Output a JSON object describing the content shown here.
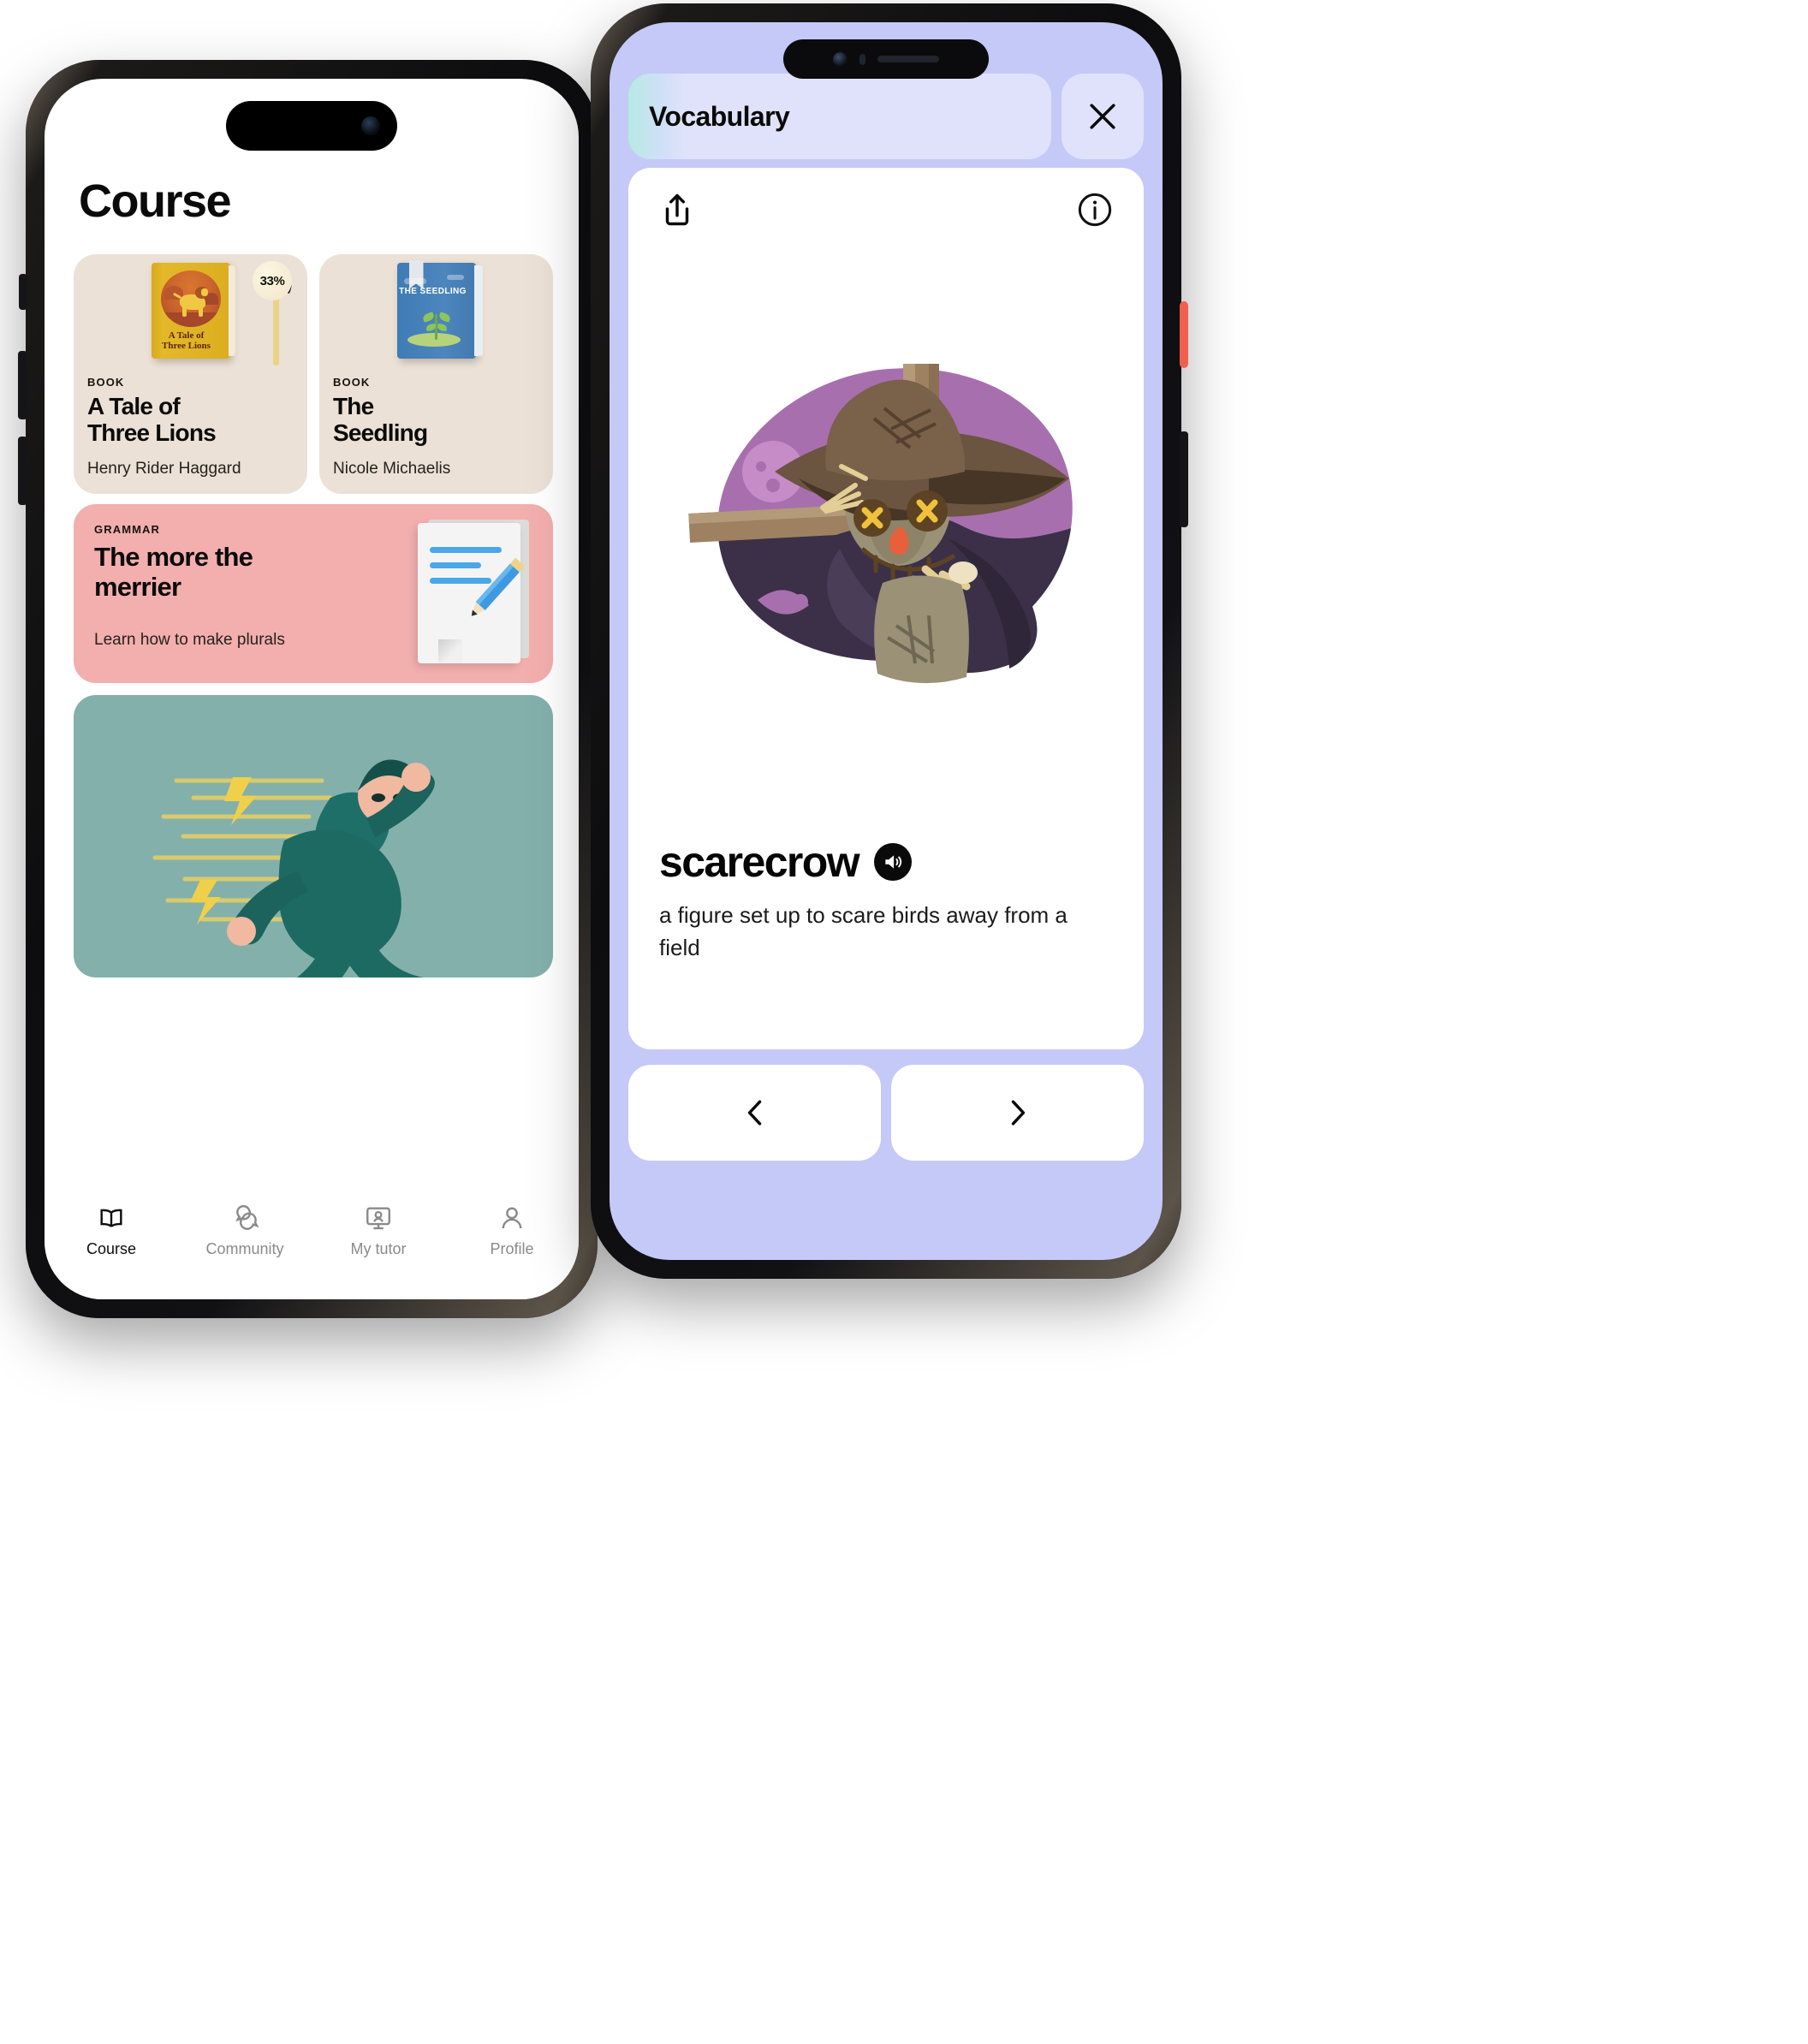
{
  "left_phone": {
    "app": {
      "page_title": "Course"
    },
    "cards": [
      {
        "kicker": "BOOK",
        "title": "A Tale of\nThree Lions",
        "title_line1": "A Tale of",
        "title_line2": "Three Lions",
        "author": "Henry Rider Haggard",
        "progress_label": "33%",
        "progress_value": 33,
        "cover_title_line1": "A Tale of",
        "cover_title_line2": "Three Lions",
        "card_bg": "#ece1d6"
      },
      {
        "kicker": "BOOK",
        "title_line1": "The",
        "title_line2": "Seedling",
        "author": "Nicole Michaelis",
        "cover_title": "THE SEEDLING",
        "card_bg": "#ece1d6"
      }
    ],
    "grammar_card": {
      "kicker": "GRAMMAR",
      "title_line1": "The more the",
      "title_line2": "merrier",
      "subtitle": "Learn how to make plurals",
      "bg": "#f2afae"
    },
    "hero_card": {
      "bg": "#84b0ab"
    },
    "tabbar": {
      "items": [
        {
          "label": "Course",
          "icon": "open-book-icon",
          "active": true
        },
        {
          "label": "Community",
          "icon": "chat-bubbles-icon",
          "active": false
        },
        {
          "label": "My tutor",
          "icon": "monitor-person-icon",
          "active": false
        },
        {
          "label": "Profile",
          "icon": "person-icon",
          "active": false
        }
      ]
    }
  },
  "right_phone": {
    "header": {
      "tab_label": "Vocabulary",
      "close_icon": "close-icon",
      "background": "#c5c9f7"
    },
    "card": {
      "share_icon": "share-icon",
      "info_icon": "info-icon",
      "illustration": "scarecrow-illustration",
      "word": "scarecrow",
      "speaker_icon": "speaker-icon",
      "definition": "a figure set up to scare birds away from a field"
    },
    "nav": {
      "prev_icon": "chevron-left-icon",
      "next_icon": "chevron-right-icon"
    }
  }
}
